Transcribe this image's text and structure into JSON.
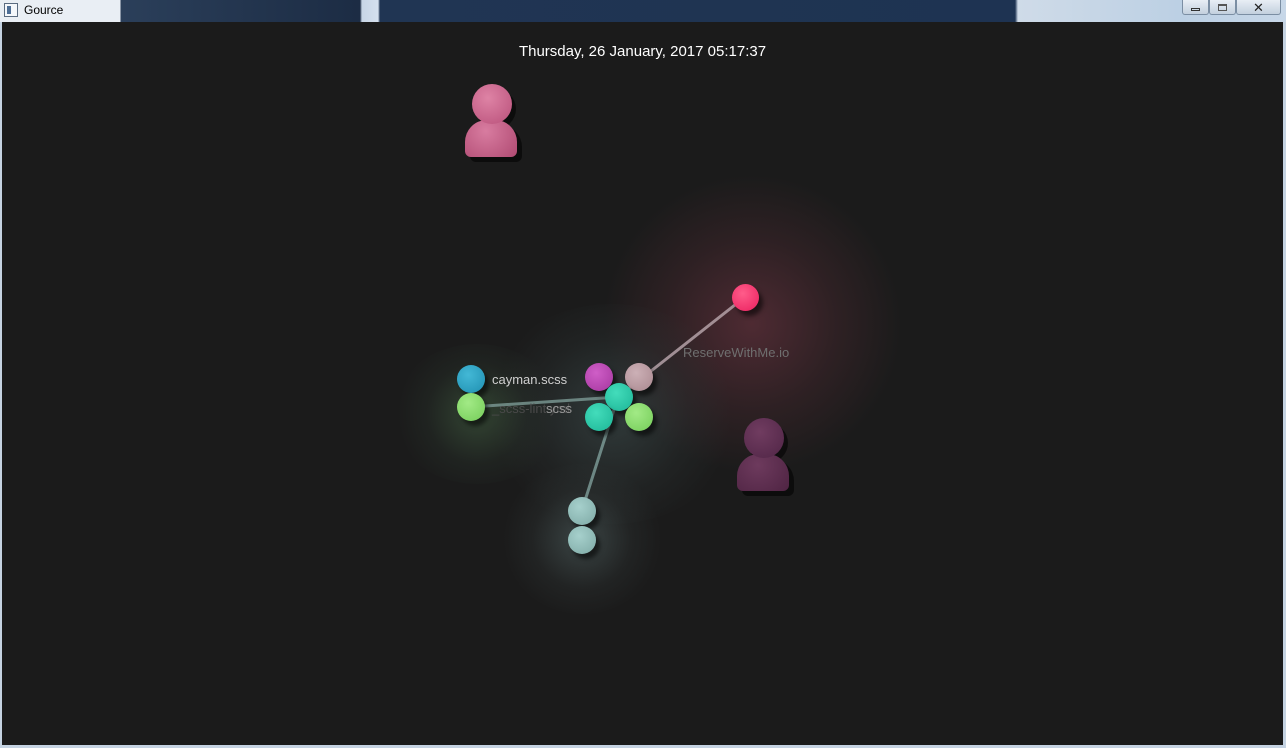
{
  "window": {
    "title": "Gource"
  },
  "visualization": {
    "date": "Thursday, 26 January, 2017 05:17:37",
    "repository_label": "ReserveWithMe.io",
    "directory_label": "scss",
    "files": [
      {
        "label": "cayman.scss",
        "color": "#2aa2c4"
      },
      {
        "label": "_scss-lint.yml",
        "color": "#86dd6a"
      }
    ],
    "colors": {
      "background": "#1b1b1b",
      "file_pink": "#ff2e6e",
      "file_mauve": "#b8959c",
      "file_purple": "#b740b0",
      "file_teal": "#22c9a6",
      "file_green": "#86dd6a",
      "file_grey_teal": "#8cb9b5",
      "user1": "#c4567e",
      "user2": "#5e2c4e"
    }
  }
}
